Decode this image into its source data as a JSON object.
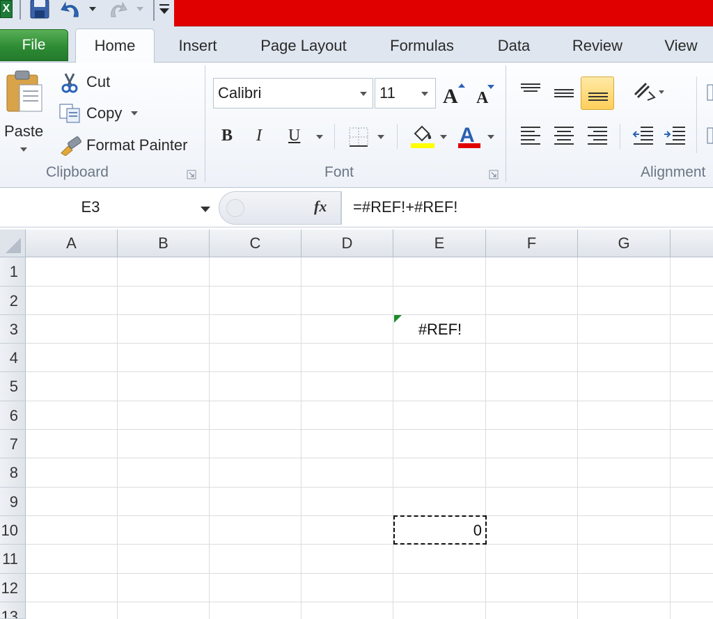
{
  "quick_access": {
    "app_icon_letter": "X",
    "icons": [
      "excel-logo-icon",
      "save-icon",
      "undo-icon",
      "redo-icon",
      "customize-quick-access-icon"
    ]
  },
  "colors": {
    "title_bar_accent": "#e00000",
    "file_tab": "#2e8c35",
    "error_indicator": "#1d8a2c",
    "active_button": "#ffcf5a"
  },
  "tabs": {
    "file": "File",
    "home": "Home",
    "insert": "Insert",
    "page_layout": "Page Layout",
    "formulas": "Formulas",
    "data": "Data",
    "review": "Review",
    "view": "View",
    "active": "Home"
  },
  "clipboard": {
    "paste": "Paste",
    "cut": "Cut",
    "copy": "Copy",
    "format_painter": "Format Painter",
    "label": "Clipboard"
  },
  "font": {
    "name": "Calibri",
    "size": "11",
    "label": "Font",
    "bold": "B",
    "italic": "I",
    "underline": "U"
  },
  "alignment": {
    "label": "Alignment"
  },
  "formula_bar": {
    "name_box": "E3",
    "fx": "fx",
    "formula": "=#REF!+#REF!"
  },
  "columns": [
    "A",
    "B",
    "C",
    "D",
    "E",
    "F",
    "G"
  ],
  "rows": [
    "1",
    "2",
    "3",
    "4",
    "5",
    "6",
    "7",
    "8",
    "9",
    "10",
    "11",
    "12",
    "13"
  ],
  "cells": {
    "E3": "#REF!",
    "E10": "0"
  },
  "active_cell": "E3",
  "copy_range": "E10"
}
